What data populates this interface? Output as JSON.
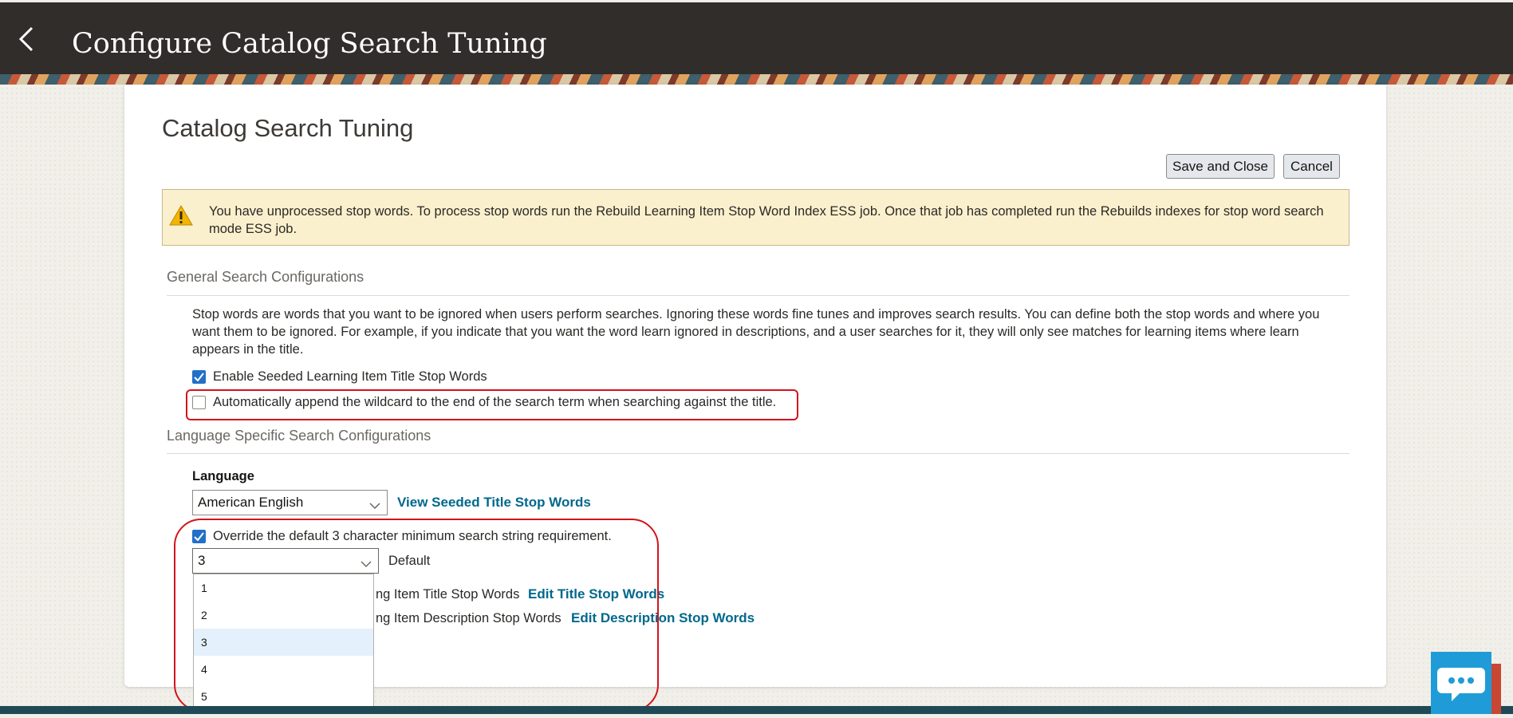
{
  "header": {
    "title": "Configure Catalog Search Tuning"
  },
  "page": {
    "heading": "Catalog Search Tuning"
  },
  "toolbar": {
    "save_close_label": "Save and Close",
    "cancel_label": "Cancel"
  },
  "warning": {
    "text": "You have unprocessed stop words. To process stop words run the Rebuild Learning Item Stop Word Index ESS job. Once that job has completed run the Rebuilds indexes for stop word search mode ESS job."
  },
  "general": {
    "section_title": "General Search Configurations",
    "description": "Stop words are words that you want to be ignored when users perform searches. Ignoring these words fine tunes and improves search results. You can define both the stop words and where you want them to be ignored. For example, if you indicate that you want the word learn ignored in descriptions, and a user searches for it, they will only see matches for learning items where learn appears in the title.",
    "enable_seeded_label": "Enable Seeded Learning Item Title Stop Words",
    "enable_seeded_checked": true,
    "wildcard_label": "Automatically append the wildcard to the end of the search term when searching against the title.",
    "wildcard_checked": false
  },
  "language_section": {
    "section_title": "Language Specific Search Configurations",
    "language_label": "Language",
    "language_value": "American English",
    "view_seeded_link": "View Seeded Title Stop Words",
    "override_label": "Override the default 3 character minimum search string requirement.",
    "override_checked": true,
    "min_chars_value": "3",
    "default_label": "Default",
    "title_stop_words_label": "ng Item Title Stop Words",
    "edit_title_link": "Edit Title Stop Words",
    "description_stop_words_label": "ng Item Description Stop Words",
    "edit_description_link": "Edit Description Stop Words",
    "dropdown_options": [
      "1",
      "2",
      "3",
      "4",
      "5"
    ],
    "dropdown_selected": "3"
  },
  "colors": {
    "header_bg": "#312d2a",
    "link": "#00688c",
    "annotation": "#d2141b",
    "checkbox": "#2270c7",
    "chat": "#1f9cd7"
  }
}
